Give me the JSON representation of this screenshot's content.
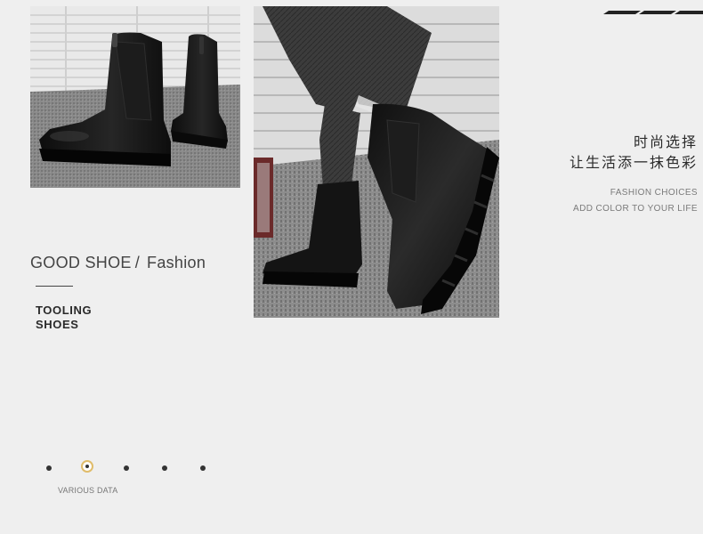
{
  "right_text": {
    "cn_line1": "时尚选择",
    "cn_line2": "让生活添一抹色彩",
    "en_line1": "FASHION CHOICES",
    "en_line2": "ADD COLOR TO YOUR LIFE"
  },
  "left_text": {
    "good_shoe": "GOOD SHOE",
    "separator": "/",
    "fashion": "Fashion",
    "tooling_line1": "TOOLING",
    "tooling_line2": "SHOES"
  },
  "pager": {
    "label": "VARIOUS DATA",
    "count": 5,
    "active_index": 1
  },
  "colors": {
    "background": "#efefef",
    "accent_ring": "#e0bc6a",
    "boot": "#151515",
    "text": "#333333"
  },
  "images": {
    "left": "boots-on-carpet-photo",
    "right": "boot-worn-with-jeans-photo"
  }
}
